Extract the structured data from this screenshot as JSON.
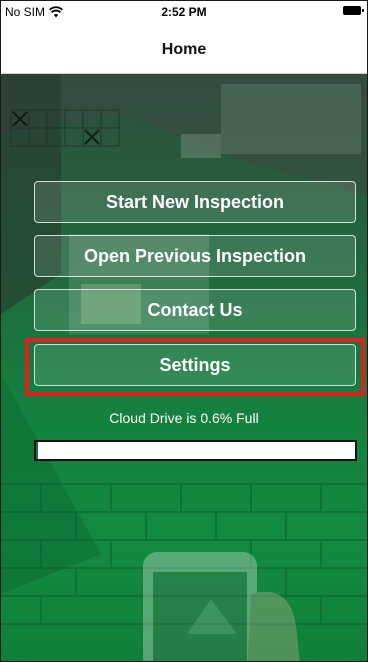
{
  "status_bar": {
    "carrier": "No SIM",
    "time": "2:52 PM",
    "wifi_icon": "wifi-icon",
    "battery_icon": "battery-full-icon"
  },
  "nav": {
    "title": "Home"
  },
  "menu": {
    "start_new": "Start New Inspection",
    "open_previous": "Open Previous Inspection",
    "contact_us": "Contact Us",
    "settings": "Settings"
  },
  "storage": {
    "label": "Cloud Drive is 0.6% Full",
    "percent_full": 0.6
  },
  "colors": {
    "accent_green": "#138a41",
    "highlight": "#e02020"
  }
}
